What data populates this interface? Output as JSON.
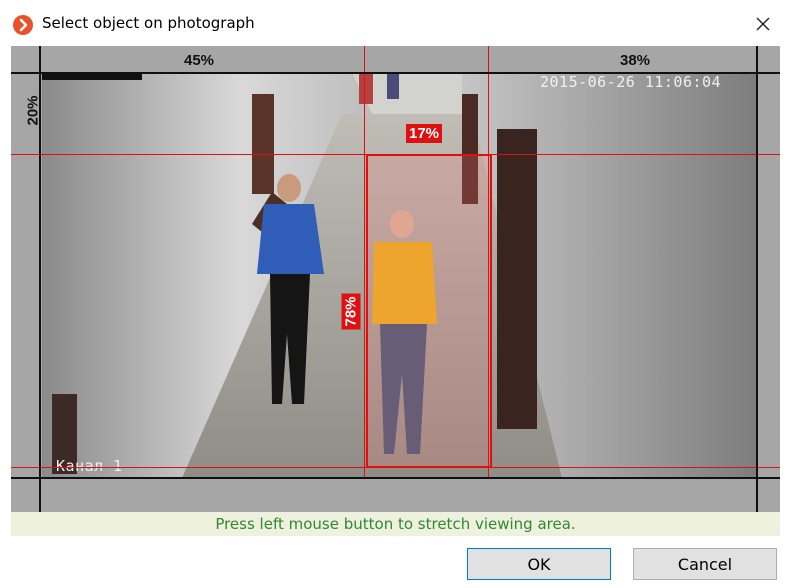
{
  "window": {
    "title": "Select object on photograph",
    "app_icon": "chevron-right-circle-icon",
    "close_icon": "close-icon"
  },
  "ruler": {
    "top_left_percent": "45%",
    "top_right_percent": "38%",
    "left_percent": "20%"
  },
  "photo": {
    "timestamp": "2015-06-26 11:06:04",
    "camera_label": "Канал 1"
  },
  "selection": {
    "top_percent_label": "17%",
    "left_percent_label": "78%"
  },
  "hint": {
    "text": "Press left mouse button to stretch viewing area."
  },
  "buttons": {
    "ok_label": "OK",
    "cancel_label": "Cancel"
  },
  "colors": {
    "accent_red": "#e01010",
    "hint_text": "#2f8a2f",
    "hint_bg": "#eef1de",
    "app_icon": "#e8512a"
  }
}
